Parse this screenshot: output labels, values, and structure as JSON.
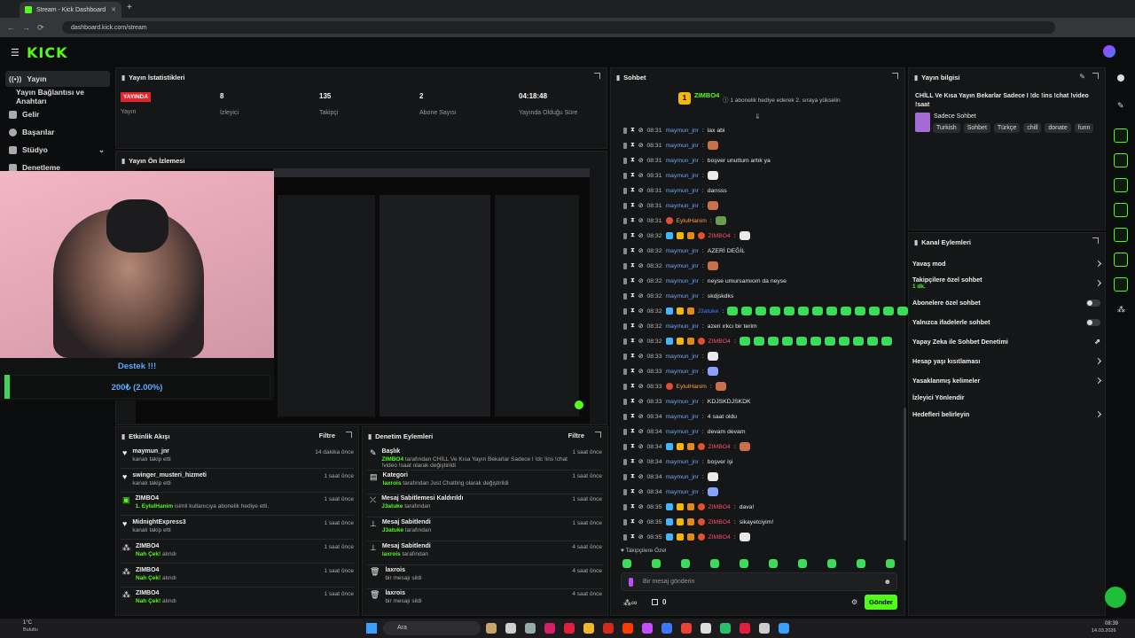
{
  "browser": {
    "tab_title": "Stream - Kick Dashboard",
    "url": "dashboard.kick.com/stream"
  },
  "app": {
    "logo": "KICK"
  },
  "sidebar": {
    "items": [
      {
        "label": "Yayın"
      },
      {
        "label": "Yayın Bağlantısı ve Anahtarı"
      },
      {
        "label": "Gelir"
      },
      {
        "label": "Başarılar"
      },
      {
        "label": "Stüdyo"
      },
      {
        "label": "Denetleme"
      }
    ]
  },
  "stats": {
    "title": "Yayın İstatistikleri",
    "live_badge": "YAYINDA",
    "items": [
      {
        "value": "",
        "label": "Yayın"
      },
      {
        "value": "8",
        "label": "İzleyici"
      },
      {
        "value": "135",
        "label": "Takipçi"
      },
      {
        "value": "2",
        "label": "Abone Sayısı"
      },
      {
        "value": "04:18:48",
        "label": "Yayında Olduğu Süre"
      }
    ]
  },
  "preview": {
    "title": "Yayın Ön İzlemesi"
  },
  "donation": {
    "title": "Destek !!!",
    "amount": "200₺ (2.00%)"
  },
  "chat": {
    "title": "Sohbet",
    "pinned_user": "ZIMBO4",
    "pinned_note": "1 abonelik hediye ederek 2. sıraya yükselin",
    "followers_label": "Takipçilere Özel",
    "input_placeholder": "Bir mesaj gönderin",
    "send": "Gönder",
    "count": "0",
    "messages": [
      {
        "time": "08:31",
        "user": "maymun_jnr",
        "text": "lax abi",
        "kind": "plain"
      },
      {
        "time": "08:31",
        "user": "maymun_jnr",
        "text": "",
        "kind": "plain"
      },
      {
        "time": "08:31",
        "user": "maymun_jnr",
        "text": "boşver unuttum artık ya",
        "kind": "plain"
      },
      {
        "time": "08:31",
        "user": "maymun_jnr",
        "text": "",
        "kind": "plain"
      },
      {
        "time": "08:31",
        "user": "maymun_jnr",
        "text": "darısss",
        "kind": "plain"
      },
      {
        "time": "08:31",
        "user": "maymun_jnr",
        "text": "",
        "kind": "plain"
      },
      {
        "time": "08:31",
        "user": "EylulHanim",
        "text": "",
        "kind": "org"
      },
      {
        "time": "08:32",
        "user": "ZIMBO4",
        "text": "",
        "kind": "red"
      },
      {
        "time": "08:32",
        "user": "maymun_jnr",
        "text": "AZERİ DEĞİL",
        "kind": "plain"
      },
      {
        "time": "08:32",
        "user": "maymun_jnr",
        "text": "",
        "kind": "plain"
      },
      {
        "time": "08:32",
        "user": "maymun_jnr",
        "text": "neyse umursamıom da neyse",
        "kind": "plain"
      },
      {
        "time": "08:32",
        "user": "maymun_jnr",
        "text": "skdjskdks",
        "kind": "plain"
      },
      {
        "time": "08:32",
        "user": "J3atuke",
        "text": "",
        "kind": "ej"
      },
      {
        "time": "08:32",
        "user": "maymun_jnr",
        "text": "azeri ırkcı bir terim",
        "kind": "plain"
      },
      {
        "time": "08:32",
        "user": "ZIMBO4",
        "text": "",
        "kind": "red"
      },
      {
        "time": "08:33",
        "user": "maymun_jnr",
        "text": "",
        "kind": "plain"
      },
      {
        "time": "08:33",
        "user": "maymun_jnr",
        "text": "",
        "kind": "plain"
      },
      {
        "time": "08:33",
        "user": "EylulHanim",
        "text": "",
        "kind": "org"
      },
      {
        "time": "08:33",
        "user": "maymun_jnr",
        "text": "KDJSKDJSKDK",
        "kind": "plain"
      },
      {
        "time": "08:34",
        "user": "maymun_jnr",
        "text": "4 saat oldu",
        "kind": "plain"
      },
      {
        "time": "08:34",
        "user": "maymun_jnr",
        "text": "devam devam",
        "kind": "plain"
      },
      {
        "time": "08:34",
        "user": "ZIMBO4",
        "text": "",
        "kind": "red"
      },
      {
        "time": "08:34",
        "user": "maymun_jnr",
        "text": "boşver işi",
        "kind": "plain"
      },
      {
        "time": "08:34",
        "user": "maymun_jnr",
        "text": "",
        "kind": "plain"
      },
      {
        "time": "08:34",
        "user": "maymun_jnr",
        "text": "",
        "kind": "plain"
      },
      {
        "time": "08:35",
        "user": "ZIMBO4",
        "text": "dava!",
        "kind": "red"
      },
      {
        "time": "08:35",
        "user": "ZIMBO4",
        "text": "sikayetciyim!",
        "kind": "red"
      },
      {
        "time": "08:35",
        "user": "ZIMBO4",
        "text": "",
        "kind": "red"
      }
    ]
  },
  "stream_info": {
    "title": "Yayın bilgisi",
    "stream_title": "CHİLL Ve Kısa Yayın Bekarlar Sadece I !dc !ins !chat !video !saat",
    "category": "Sadece Sohbet",
    "tags": [
      "Turkish",
      "Sohbet",
      "Türkçe",
      "chill",
      "donate",
      "funn"
    ]
  },
  "channel_actions": {
    "title": "Kanal Eylemleri",
    "items": [
      {
        "label": "Yavaş mod",
        "sub": "",
        "control": "chevron"
      },
      {
        "label": "Takipçilere özel sohbet",
        "sub": "1 dk.",
        "control": "chevron"
      },
      {
        "label": "Abonelere özel sohbet",
        "sub": "",
        "control": "toggle"
      },
      {
        "label": "Yalnızca ifadelerle sohbet",
        "sub": "",
        "control": "toggle"
      },
      {
        "label": "Yapay Zeka ile Sohbet Denetimi",
        "sub": "",
        "control": "link"
      },
      {
        "label": "Hesap yaşı kısıtlaması",
        "sub": "",
        "control": "chevron"
      },
      {
        "label": "Yasaklanmış kelimeler",
        "sub": "",
        "control": "chevron"
      },
      {
        "label": "İzleyici Yönlendir",
        "sub": "",
        "control": "none"
      },
      {
        "label": "Hedefleri belirleyin",
        "sub": "",
        "control": "chevron"
      }
    ]
  },
  "activity": {
    "title": "Etkinlik Akışı",
    "filter": "Filtre",
    "items": [
      {
        "name": "maymun_jnr",
        "desc": "kanalı takip etti",
        "green": "",
        "time": "14 dakika önce"
      },
      {
        "name": "swinger_musteri_hizmeti",
        "desc": "kanalı takip etti",
        "green": "",
        "time": "1 saat önce"
      },
      {
        "name": "ZIMBO4",
        "desc": "isimli kullanıcıya abonelik hediye etti.",
        "green": "1. EylulHanim",
        "time": "1 saat önce"
      },
      {
        "name": "MidnightExpress3",
        "desc": "kanalı takip etti",
        "green": "",
        "time": "1 saat önce"
      },
      {
        "name": "ZIMBO4",
        "desc": "alındı",
        "green": "Nah Çek!",
        "time": "1 saat önce"
      },
      {
        "name": "ZIMBO4",
        "desc": "alındı",
        "green": "Nah Çek!",
        "time": "1 saat önce"
      },
      {
        "name": "ZIMBO4",
        "desc": "alındı",
        "green": "Nah Çek!",
        "time": "1 saat önce"
      }
    ]
  },
  "moderation": {
    "title": "Denetim Eylemleri",
    "filter": "Filtre",
    "items": [
      {
        "title": "Başlık",
        "green": "ZIMBO4",
        "desc": "tarafından CHİLL Ve Kısa Yayın Bekarlar Sadece I !dc !ins !chat !video !saat olarak değiştirildi",
        "time": "1 saat önce"
      },
      {
        "title": "Kategori",
        "green": "laxrois",
        "desc": "tarafından Just Chatting olarak değiştirildi",
        "time": "1 saat önce"
      },
      {
        "title": "Mesaj Sabitlemesi Kaldırıldı",
        "green": "J3atuke",
        "desc": "tarafından",
        "time": "1 saat önce"
      },
      {
        "title": "Mesaj Sabitlendi",
        "green": "J3atuke",
        "desc": "tarafından",
        "time": "1 saat önce"
      },
      {
        "title": "Mesaj Sabitlendi",
        "green": "laxrois",
        "desc": "tarafından",
        "time": "4 saat önce"
      },
      {
        "title": "laxrois",
        "green": "",
        "desc": "bir mesajı sildi",
        "time": "4 saat önce"
      },
      {
        "title": "laxrois",
        "green": "",
        "desc": "bir mesajı sildi",
        "time": "4 saat önce"
      }
    ]
  },
  "taskbar": {
    "weather": "1°C",
    "weather_desc": "Bulutlu",
    "search": "Ara",
    "time": "08:39",
    "date": "14.03.2026"
  },
  "colors": {
    "accent": "#53fc18",
    "live": "#e5232b"
  }
}
